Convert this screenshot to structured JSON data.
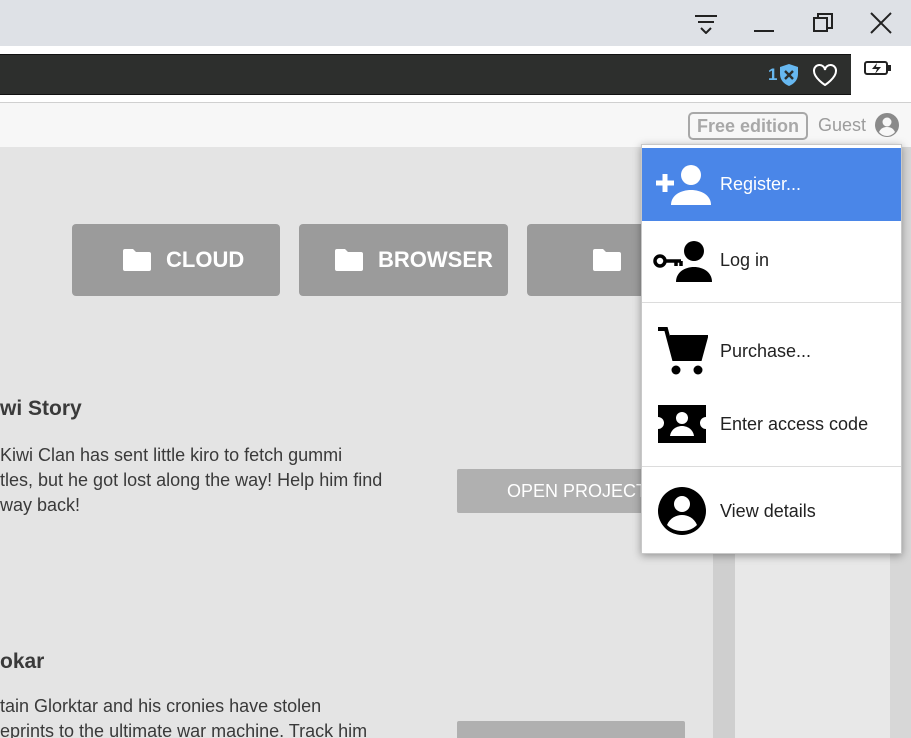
{
  "window": {
    "controls": [
      "tab-search",
      "minimize",
      "restore",
      "close"
    ]
  },
  "toolbar": {
    "extension_count": "1",
    "icons": [
      "shield-x-icon",
      "heart-icon",
      "battery-saver-icon"
    ]
  },
  "header": {
    "edition_badge": "Free edition",
    "user_label": "Guest"
  },
  "categories": [
    {
      "label": "CLOUD",
      "icon": "folder-icon"
    },
    {
      "label": "BROWSER",
      "icon": "folder-icon"
    },
    {
      "label": "",
      "icon": "folder-icon"
    }
  ],
  "projects": [
    {
      "title": "wi Story",
      "description_lines": [
        " Kiwi Clan has sent little kiro to fetch gummi",
        "tles, but he got lost along the way! Help him find",
        "way back!"
      ],
      "button_label": "OPEN PROJECT"
    },
    {
      "title": "okar",
      "description_lines": [
        "tain Glorktar and his cronies have stolen",
        "eprints to the ultimate war machine. Track him"
      ],
      "button_label": ""
    }
  ],
  "account_menu": {
    "items": [
      {
        "label": "Register...",
        "icon": "add-user-icon",
        "highlighted": true
      },
      {
        "label": "Log in",
        "icon": "key-user-icon"
      },
      {
        "label": "Purchase...",
        "icon": "cart-icon"
      },
      {
        "label": "Enter access code",
        "icon": "ticket-icon"
      },
      {
        "label": "View details",
        "icon": "account-circle-icon"
      }
    ]
  },
  "colors": {
    "menu_highlight": "#4a86e8",
    "button_gray": "#9b9b9b",
    "open_button": "#b0b0b0",
    "omnibox": "#2d2f2d",
    "extension_blue": "#67b8f0"
  }
}
